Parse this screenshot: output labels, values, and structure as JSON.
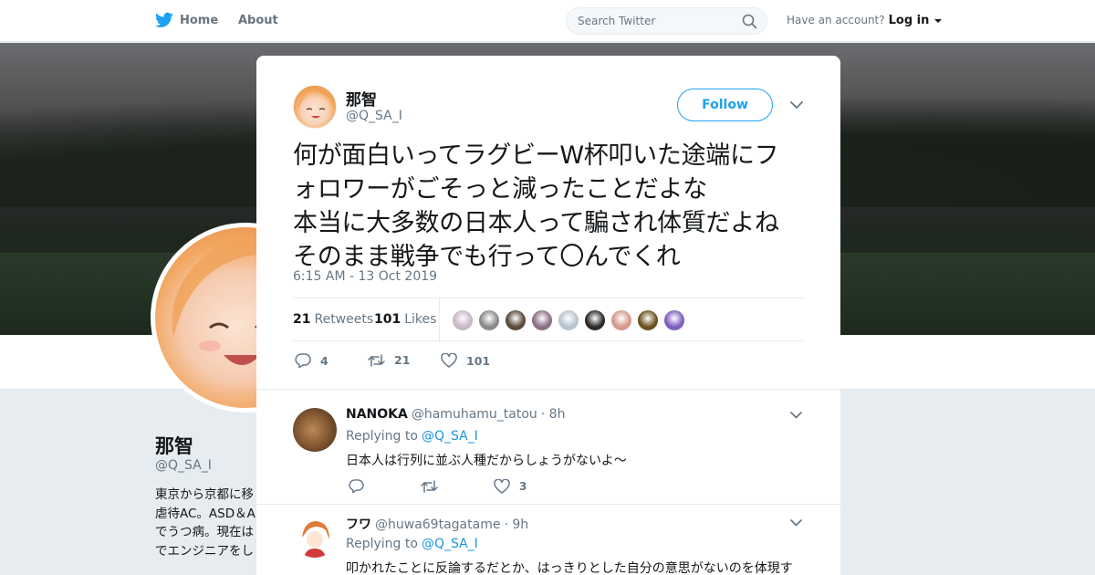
{
  "nav": {
    "home_label": "Home",
    "about_label": "About",
    "search_placeholder": "Search Twitter",
    "account_prompt": "Have an account?",
    "login_label": "Log in"
  },
  "profile": {
    "name": "那智",
    "handle": "@Q_SA_I",
    "bio_lines": [
      "東京から京都に移",
      "虐待AC。ASD＆A",
      "でうつ病。現在は",
      "でエンジニアをし"
    ]
  },
  "tweet": {
    "author_name": "那智",
    "author_handle": "@Q_SA_I",
    "follow_label": "Follow",
    "text_lines": [
      "何が面白いってラグビーW杯叩いた途端にフ",
      "ォロワーがごそっと減ったことだよな",
      "本当に大多数の日本人って騙され体質だよね",
      "そのまま戦争でも行って〇んでくれ"
    ],
    "timestamp": "6:15 AM - 13 Oct 2019",
    "retweets_count": "21",
    "retweets_label": "Retweets",
    "likes_count": "101",
    "likes_label": "Likes",
    "likers": [
      "#c9b7c9",
      "#8a8a8a",
      "#5a4a3a",
      "#8b6f86",
      "#b8c4cf",
      "#2a2a2a",
      "#d5988a",
      "#6b5321",
      "#7d5fbf"
    ],
    "reply_count": "4",
    "retweet_action_count": "21",
    "like_action_count": "101"
  },
  "replies": [
    {
      "name": "NANOKA",
      "handle": "@hamuhamu_tatou",
      "time": "· 8h",
      "replying_prefix": "Replying to",
      "replying_to": "@Q_SA_I",
      "text": "日本人は行列に並ぶ人種だからしょうがないよ〜",
      "like_count": "3"
    },
    {
      "name": "フワ",
      "handle": "@huwa69tagatame",
      "time": "· 9h",
      "replying_prefix": "Replying to",
      "replying_to": "@Q_SA_I",
      "text": "叩かれたことに反論するだとか、はっきりとした自分の意思がないのを体現す"
    }
  ],
  "colors": {
    "accent": "#1da1f2",
    "link": "#1b95e0",
    "muted": "#657786",
    "background": "#e6ecf0"
  },
  "icons": {
    "brand": "twitter-bird-icon",
    "search": "search-icon",
    "close": "close-icon",
    "caret": "caret-down-icon",
    "chevron": "chevron-down-icon",
    "reply": "reply-icon",
    "retweet": "retweet-icon",
    "like": "heart-icon"
  }
}
